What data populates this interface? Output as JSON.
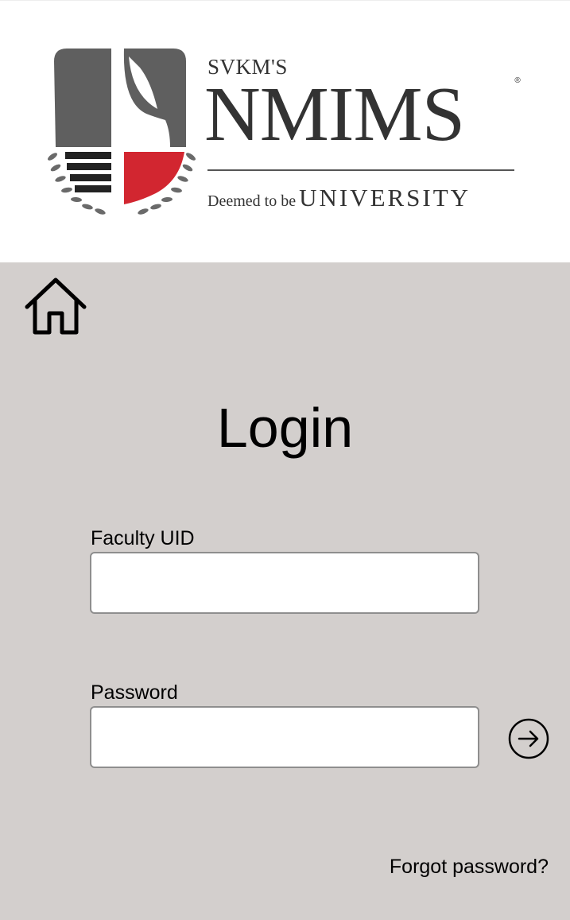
{
  "header": {
    "logo": {
      "prefix": "SVKM'S",
      "name": "NMIMS",
      "registered": "®",
      "tagline_small": "Deemed to be",
      "tagline_big": "UNIVERSITY"
    }
  },
  "icons": {
    "home": "home-icon",
    "submit": "arrow-right-circle-icon"
  },
  "login": {
    "title": "Login",
    "uid_label": "Faculty UID",
    "uid_value": "",
    "password_label": "Password",
    "password_value": "",
    "forgot_link": "Forgot password?"
  },
  "colors": {
    "page_background": "#d3cfcd",
    "header_background": "#ffffff",
    "crest_gray": "#5f5f5f",
    "crest_red": "#d22630",
    "text_dark": "#333333"
  }
}
